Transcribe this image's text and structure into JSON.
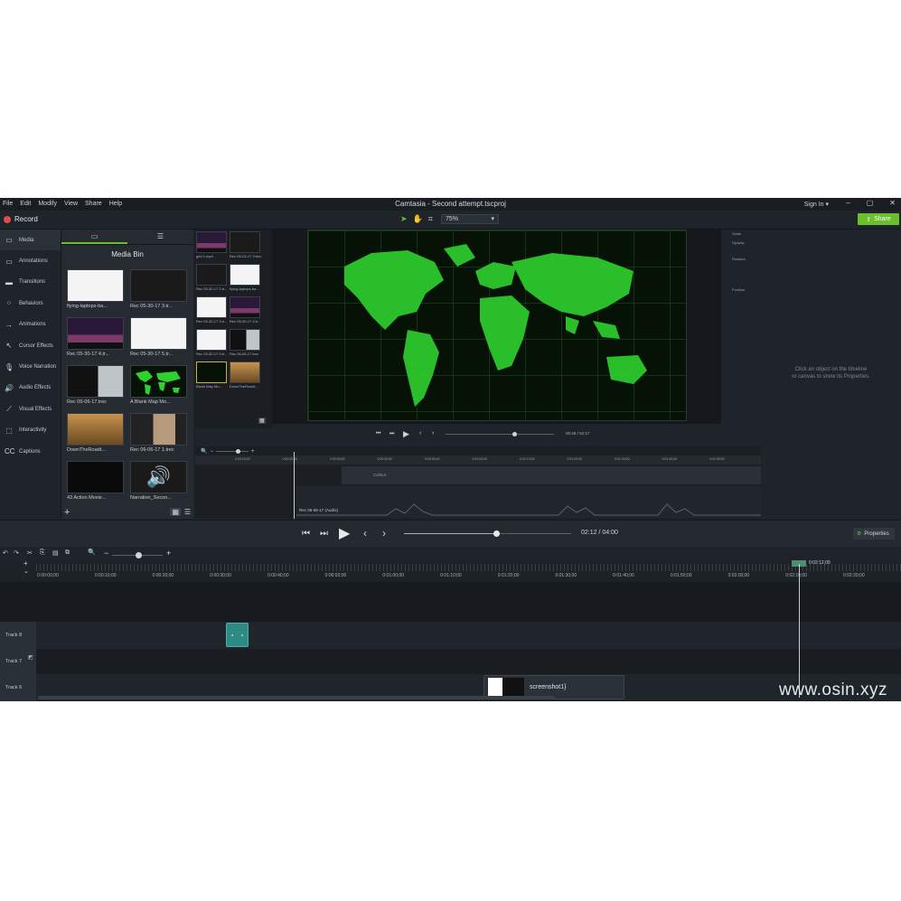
{
  "window": {
    "title": "Camtasia - Second attempt.tscproj",
    "menus": [
      "File",
      "Edit",
      "Modify",
      "View",
      "Share",
      "Help"
    ],
    "sign_in": "Sign In ▾",
    "controls": [
      "–",
      "▢",
      "✕"
    ]
  },
  "toolbar": {
    "record_label": "Record",
    "zoom_value": "75%",
    "share_label": "Share"
  },
  "sidebar": {
    "items": [
      {
        "label": "Media",
        "icon": "media-icon",
        "active": true
      },
      {
        "label": "Annotations",
        "icon": "annotations-icon"
      },
      {
        "label": "Transitions",
        "icon": "transitions-icon"
      },
      {
        "label": "Behaviors",
        "icon": "behaviors-icon"
      },
      {
        "label": "Animations",
        "icon": "animations-icon"
      },
      {
        "label": "Cursor Effects",
        "icon": "cursor-icon"
      },
      {
        "label": "Voice Narration",
        "icon": "microphone-icon"
      },
      {
        "label": "Audio Effects",
        "icon": "speaker-icon"
      },
      {
        "label": "Visual Effects",
        "icon": "wand-icon"
      },
      {
        "label": "Interactivity",
        "icon": "interactivity-icon"
      },
      {
        "label": "Captions",
        "icon": "captions-icon"
      }
    ]
  },
  "media_bin": {
    "title": "Media Bin",
    "items": [
      {
        "caption": "flying-laptops-ba...",
        "kind": "white"
      },
      {
        "caption": "Rec 05-30-17 3.tr...",
        "kind": "dark"
      },
      {
        "caption": "Rec 05-30-17 4.tr...",
        "kind": "city"
      },
      {
        "caption": "Rec 05-30-17 5.tr...",
        "kind": "white"
      },
      {
        "caption": "Rec 06-06-17.trec",
        "kind": "person"
      },
      {
        "caption": "A Blank Map Mo...",
        "kind": "map"
      },
      {
        "caption": "DownTheRoadt...",
        "kind": "road"
      },
      {
        "caption": "Rec 06-06-17 1.trec",
        "kind": "person2"
      },
      {
        "caption": "43 Action Movie...",
        "kind": "black"
      },
      {
        "caption": "Narration_Secon...",
        "kind": "audio"
      }
    ]
  },
  "clip_strip": {
    "captions": [
      "grid 1.mp4",
      "Rec 05-23-17 3.trec",
      "Rec 05-30-17 2.tr...",
      "flying-laptops-ba...",
      "Rec 05-30-17 3.tr...",
      "Rec 05-30-17 4.tr...",
      "Rec 05-30-17 5.tr...",
      "Rec 06-06-17.trec",
      "Blank Map Mo...",
      "DownTheRoadt..."
    ]
  },
  "properties_panel": {
    "labels": [
      "Scale",
      "Opacity",
      "Rotation",
      "Position"
    ],
    "hint_line1": "Click an object on the timeline",
    "hint_line2": "or canvas to show its Properties."
  },
  "mini_player": {
    "time": "00:46 / 02:17"
  },
  "mini_timeline": {
    "ticks": [
      "0:00:10;00",
      "0:00:20;00",
      "0:00:30;00",
      "0:00:40;00",
      "0:00:50;00",
      "0:01:00;00",
      "0:01:10;00",
      "0:01:20;00",
      "0:01:30;00",
      "0:01:40;00",
      "0:01:50;00"
    ],
    "callout": "Callout",
    "audio_label": "Rec 06-06-17 (Audio)"
  },
  "transport": {
    "time": "02:12",
    "total": "04:00",
    "properties_label": "Properties",
    "progress": 0.55
  },
  "timeline": {
    "playhead_time": "0:02:12;09",
    "ticks": [
      "0:00:00;00",
      "0:00:10;00",
      "0:00:20;00",
      "0:00:30;00",
      "0:00:40;00",
      "0:00:50;00",
      "0:01:00;00",
      "0:01:10;00",
      "0:01:20;00",
      "0:01:30;00",
      "0:01:40;00",
      "0:01:50;00",
      "0:02:00;00",
      "0:02:10;00",
      "0:02:20;00"
    ],
    "tracks": [
      {
        "label": "Track 8"
      },
      {
        "label": "Track 7"
      },
      {
        "label": "Track 6",
        "clip": "screenshot1}"
      }
    ]
  },
  "watermark": "www.osin.xyz",
  "colors": {
    "accent": "#6cbf2c",
    "record": "#e34b4b",
    "bg": "#1f242a"
  }
}
